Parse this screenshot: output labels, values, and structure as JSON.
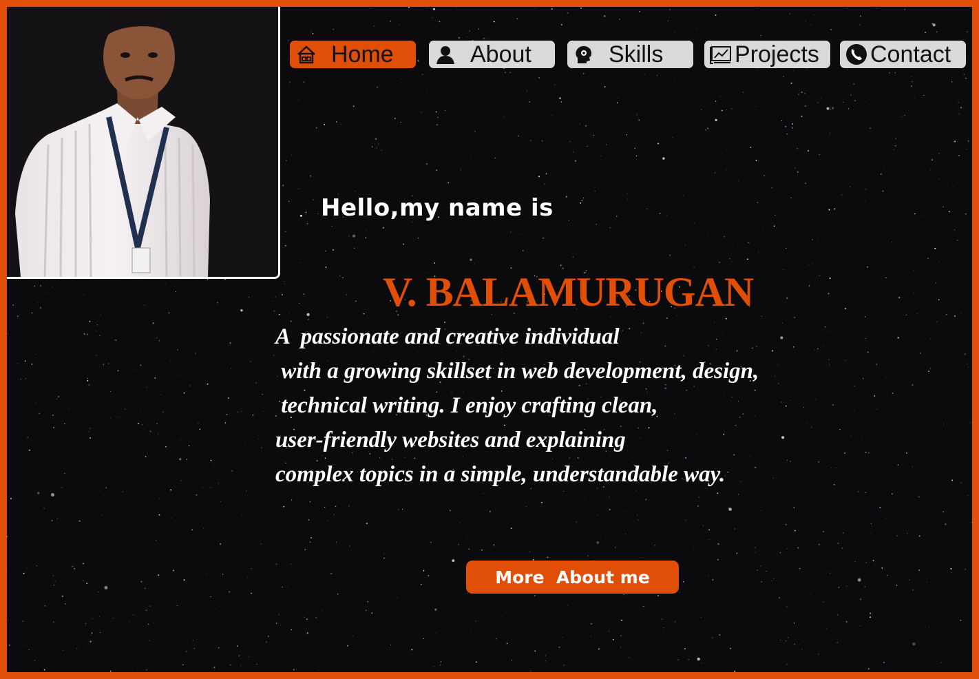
{
  "nav": {
    "items": [
      {
        "label": "Home",
        "icon": "home-icon",
        "active": true
      },
      {
        "label": "About",
        "icon": "user-icon",
        "active": false
      },
      {
        "label": "Skills",
        "icon": "brain-gear-icon",
        "active": false
      },
      {
        "label": "Projects",
        "icon": "chart-board-icon",
        "active": false
      },
      {
        "label": "Contact",
        "icon": "phone-icon",
        "active": false
      }
    ]
  },
  "hero": {
    "greeting": "Hello,my name is",
    "name": "V. BALAMURUGAN",
    "bio_lines": [
      "A  passionate and creative individual",
      " with a growing skillset in web development, design,",
      " technical writing. I enjoy crafting clean,",
      "user-friendly websites and explaining",
      "complex topics in a simple, understandable way."
    ],
    "cta_label": "More  About me"
  },
  "colors": {
    "accent": "#e04e08",
    "background": "#0b0a0c",
    "nav_button": "#d9d9d9",
    "text": "#ffffff"
  }
}
